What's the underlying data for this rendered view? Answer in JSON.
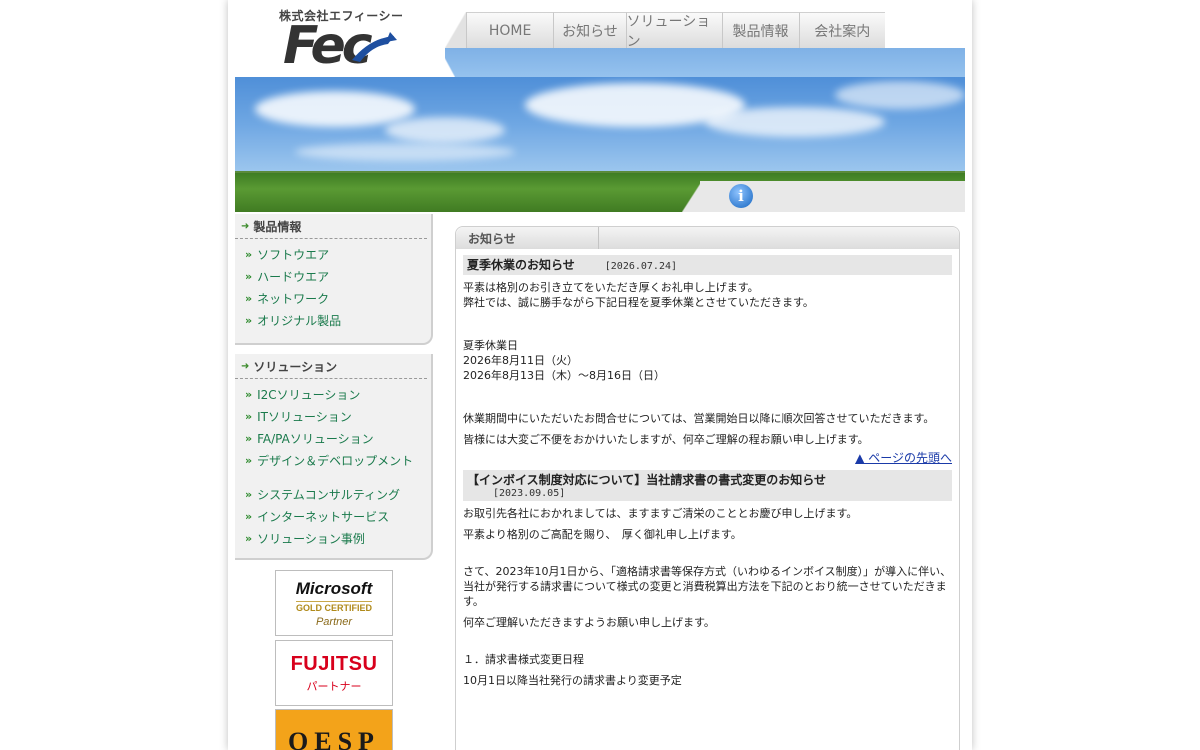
{
  "header": {
    "company_name": "株式会社エフィーシー",
    "logo_text": "Fec"
  },
  "nav": {
    "items": [
      {
        "label": "HOME"
      },
      {
        "label": "お知らせ"
      },
      {
        "label": "ソリューション"
      },
      {
        "label": "製品情報"
      },
      {
        "label": "会社案内"
      }
    ]
  },
  "hero": {
    "info_icon": "info-icon",
    "info_glyph": "i"
  },
  "sidebar": {
    "products": {
      "title": "製品情報",
      "items": [
        {
          "label": "ソフトウエア"
        },
        {
          "label": "ハードウエア"
        },
        {
          "label": "ネットワーク"
        },
        {
          "label": "オリジナル製品"
        }
      ]
    },
    "solutions": {
      "title": "ソリューション",
      "items": [
        {
          "label": "I2Cソリューション"
        },
        {
          "label": "ITソリューション"
        },
        {
          "label": "FA/PAソリューション"
        },
        {
          "label": "デザイン＆デベロップメント"
        },
        {
          "label": "システムコンサルティング"
        },
        {
          "label": "インターネットサービス"
        },
        {
          "label": "ソリューション事例"
        }
      ]
    },
    "bullet": "»",
    "badges": {
      "microsoft": {
        "top": "Microsoft",
        "mid": "GOLD CERTIFIED",
        "bottom": "Partner"
      },
      "fujitsu": {
        "top": "FUJITSU",
        "bottom": "パートナー"
      },
      "oesp": {
        "top": "OESP"
      }
    }
  },
  "main": {
    "section_title": "お知らせ",
    "articles": [
      {
        "title": "夏季休業のお知らせ",
        "date": "[2026.07.24]",
        "lines": [
          "平素は格別のお引き立てをいただき厚くお礼申し上げます。",
          "弊社では、誠に勝手ながら下記日程を夏季休業とさせていただきます。",
          "夏季休業日",
          "2026年8月11日（火）",
          "2026年8月13日（木）～8月16日（日）",
          "休業期間中にいただいたお問合せについては、営業開始日以降に順次回答させていただきます。",
          "皆様には大変ご不便をおかけいたしますが、何卒ご理解の程お願い申し上げます。"
        ]
      },
      {
        "title": "【インボイス制度対応について】当社請求書の書式変更のお知らせ",
        "date": "[2023.09.05]",
        "lines": [
          "お取引先各社におかれましては、ますますご清栄のこととお慶び申し上げます。",
          "平素より格別のご高配を賜り、　厚く御礼申し上げます。",
          "さて、2023年10月1日から、「適格請求書等保存方式（いわゆるインボイス制度）」が導入に伴い、当社が発行する請求書について様式の変更と消費税算出方法を下記のとおり統一させていただきます。",
          "何卒ご理解いただきますようお願い申し上げます。",
          "１．請求書様式変更日程",
          "10月1日以降当社発行の請求書より変更予定"
        ]
      }
    ],
    "top_link": "▲ ページの先頭へ"
  }
}
